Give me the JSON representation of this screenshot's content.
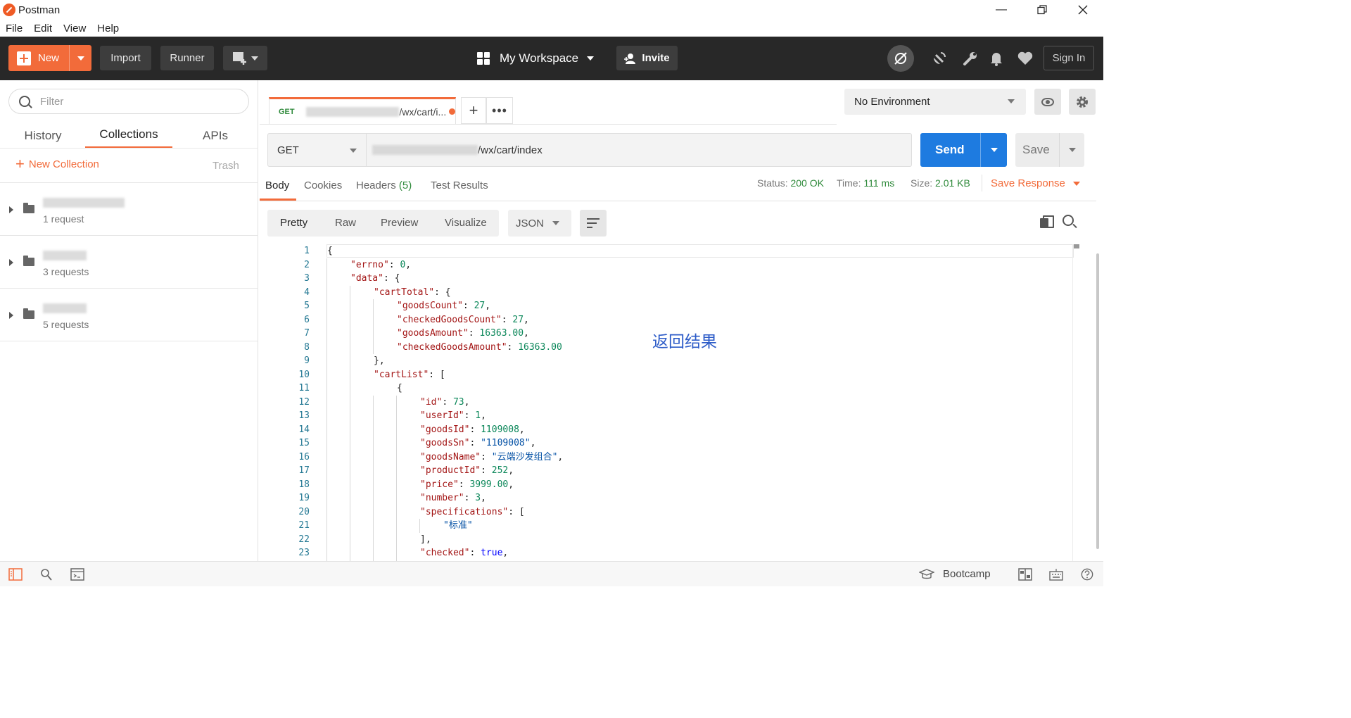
{
  "window": {
    "title": "Postman",
    "controls": [
      "minimize",
      "restore",
      "close"
    ]
  },
  "menu": [
    "File",
    "Edit",
    "View",
    "Help"
  ],
  "header": {
    "new_label": "New",
    "import_label": "Import",
    "runner_label": "Runner",
    "workspace_label": "My Workspace",
    "invite_label": "Invite",
    "signin_label": "Sign In"
  },
  "sidebar": {
    "filter_placeholder": "Filter",
    "tabs": [
      "History",
      "Collections",
      "APIs"
    ],
    "active_tab": "Collections",
    "new_collection_label": "New Collection",
    "trash_label": "Trash",
    "collections": [
      {
        "count": "1 request"
      },
      {
        "count": "3 requests"
      },
      {
        "count": "5 requests"
      }
    ]
  },
  "request_tab": {
    "method": "GET",
    "url_suffix": "/wx/cart/i...",
    "unsaved": true
  },
  "environment": {
    "selected": "No Environment"
  },
  "request": {
    "method": "GET",
    "url_suffix": "/wx/cart/index",
    "send_label": "Send",
    "save_label": "Save"
  },
  "response_tabs": {
    "body": "Body",
    "cookies": "Cookies",
    "headers": "Headers",
    "headers_count": "(5)",
    "test_results": "Test Results"
  },
  "response_meta": {
    "status_label": "Status:",
    "status_value": "200 OK",
    "time_label": "Time:",
    "time_value": "111 ms",
    "size_label": "Size:",
    "size_value": "2.01 KB",
    "save_response_label": "Save Response"
  },
  "view_tabs": [
    "Pretty",
    "Raw",
    "Preview",
    "Visualize"
  ],
  "active_view": "Pretty",
  "format": "JSON",
  "annotation": "返回结果",
  "code_lines": [
    {
      "n": "1",
      "indent": 0,
      "parts": [
        [
          "p",
          "{"
        ]
      ]
    },
    {
      "n": "2",
      "indent": 1,
      "parts": [
        [
          "k",
          "\"errno\""
        ],
        [
          "p",
          ": "
        ],
        [
          "n",
          "0"
        ],
        [
          "p",
          ","
        ]
      ]
    },
    {
      "n": "3",
      "indent": 1,
      "parts": [
        [
          "k",
          "\"data\""
        ],
        [
          "p",
          ": {"
        ]
      ]
    },
    {
      "n": "4",
      "indent": 2,
      "parts": [
        [
          "k",
          "\"cartTotal\""
        ],
        [
          "p",
          ": {"
        ]
      ]
    },
    {
      "n": "5",
      "indent": 3,
      "parts": [
        [
          "k",
          "\"goodsCount\""
        ],
        [
          "p",
          ": "
        ],
        [
          "n",
          "27"
        ],
        [
          "p",
          ","
        ]
      ]
    },
    {
      "n": "6",
      "indent": 3,
      "parts": [
        [
          "k",
          "\"checkedGoodsCount\""
        ],
        [
          "p",
          ": "
        ],
        [
          "n",
          "27"
        ],
        [
          "p",
          ","
        ]
      ]
    },
    {
      "n": "7",
      "indent": 3,
      "parts": [
        [
          "k",
          "\"goodsAmount\""
        ],
        [
          "p",
          ": "
        ],
        [
          "n",
          "16363.00"
        ],
        [
          "p",
          ","
        ]
      ]
    },
    {
      "n": "8",
      "indent": 3,
      "parts": [
        [
          "k",
          "\"checkedGoodsAmount\""
        ],
        [
          "p",
          ": "
        ],
        [
          "n",
          "16363.00"
        ]
      ]
    },
    {
      "n": "9",
      "indent": 2,
      "parts": [
        [
          "p",
          "},"
        ]
      ]
    },
    {
      "n": "10",
      "indent": 2,
      "parts": [
        [
          "k",
          "\"cartList\""
        ],
        [
          "p",
          ": ["
        ]
      ]
    },
    {
      "n": "11",
      "indent": 3,
      "parts": [
        [
          "p",
          "{"
        ]
      ]
    },
    {
      "n": "12",
      "indent": 4,
      "parts": [
        [
          "k",
          "\"id\""
        ],
        [
          "p",
          ": "
        ],
        [
          "n",
          "73"
        ],
        [
          "p",
          ","
        ]
      ]
    },
    {
      "n": "13",
      "indent": 4,
      "parts": [
        [
          "k",
          "\"userId\""
        ],
        [
          "p",
          ": "
        ],
        [
          "n",
          "1"
        ],
        [
          "p",
          ","
        ]
      ]
    },
    {
      "n": "14",
      "indent": 4,
      "parts": [
        [
          "k",
          "\"goodsId\""
        ],
        [
          "p",
          ": "
        ],
        [
          "n",
          "1109008"
        ],
        [
          "p",
          ","
        ]
      ]
    },
    {
      "n": "15",
      "indent": 4,
      "parts": [
        [
          "k",
          "\"goodsSn\""
        ],
        [
          "p",
          ": "
        ],
        [
          "s",
          "\"1109008\""
        ],
        [
          "p",
          ","
        ]
      ]
    },
    {
      "n": "16",
      "indent": 4,
      "parts": [
        [
          "k",
          "\"goodsName\""
        ],
        [
          "p",
          ": "
        ],
        [
          "s",
          "\"云端沙发组合\""
        ],
        [
          "p",
          ","
        ]
      ]
    },
    {
      "n": "17",
      "indent": 4,
      "parts": [
        [
          "k",
          "\"productId\""
        ],
        [
          "p",
          ": "
        ],
        [
          "n",
          "252"
        ],
        [
          "p",
          ","
        ]
      ]
    },
    {
      "n": "18",
      "indent": 4,
      "parts": [
        [
          "k",
          "\"price\""
        ],
        [
          "p",
          ": "
        ],
        [
          "n",
          "3999.00"
        ],
        [
          "p",
          ","
        ]
      ]
    },
    {
      "n": "19",
      "indent": 4,
      "parts": [
        [
          "k",
          "\"number\""
        ],
        [
          "p",
          ": "
        ],
        [
          "n",
          "3"
        ],
        [
          "p",
          ","
        ]
      ]
    },
    {
      "n": "20",
      "indent": 4,
      "parts": [
        [
          "k",
          "\"specifications\""
        ],
        [
          "p",
          ": ["
        ]
      ]
    },
    {
      "n": "21",
      "indent": 5,
      "parts": [
        [
          "s",
          "\"标准\""
        ]
      ]
    },
    {
      "n": "22",
      "indent": 4,
      "parts": [
        [
          "p",
          "],"
        ]
      ]
    },
    {
      "n": "23",
      "indent": 4,
      "parts": [
        [
          "k",
          "\"checked\""
        ],
        [
          "p",
          ": "
        ],
        [
          "b",
          "true"
        ],
        [
          "p",
          ","
        ]
      ]
    }
  ],
  "statusbar": {
    "bootcamp_label": "Bootcamp"
  },
  "colors": {
    "accent": "#f26b3a",
    "send": "#1e7be0",
    "success": "#2f8a3b",
    "annotation": "#2d5cc8"
  }
}
